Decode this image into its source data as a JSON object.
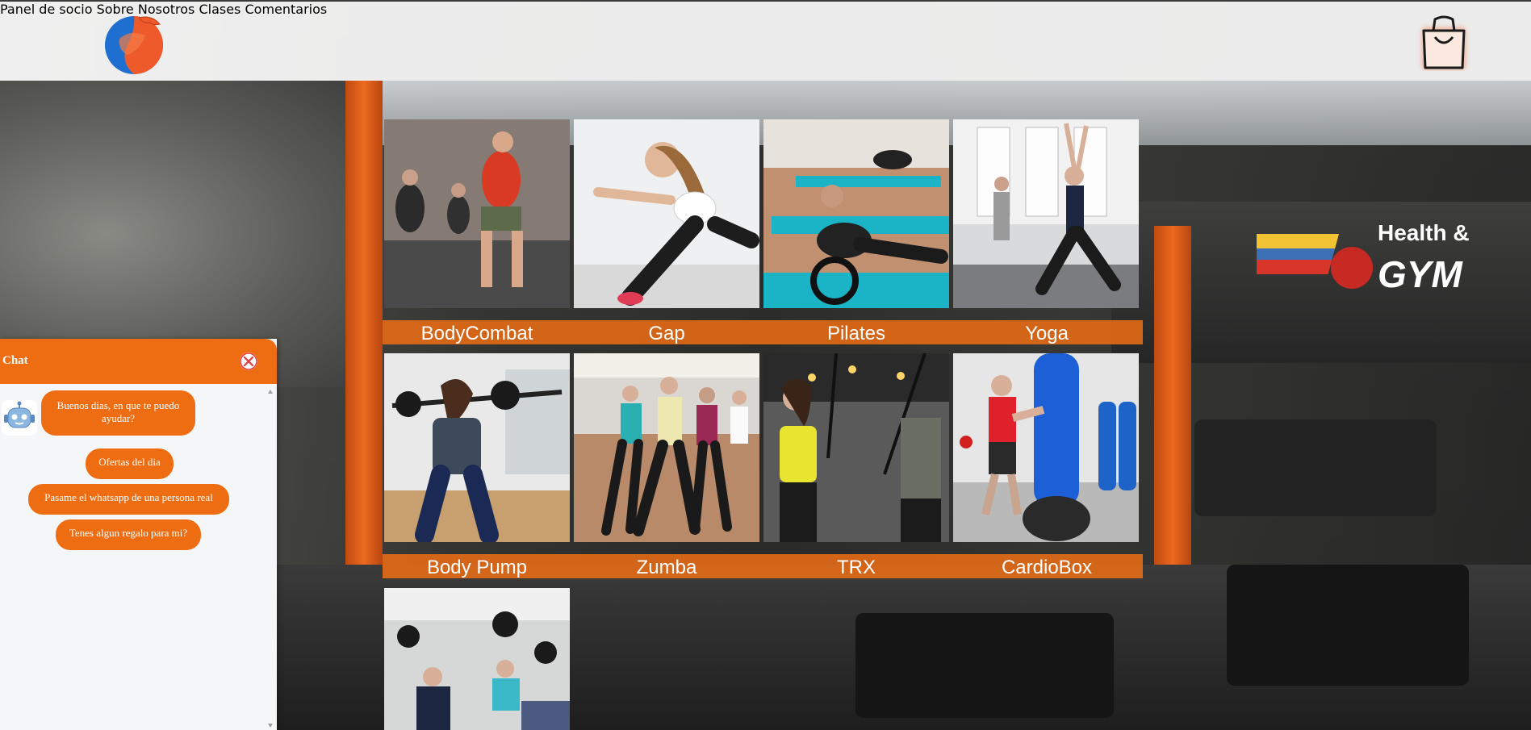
{
  "header": {
    "nav": [
      {
        "label": "Panel de socio"
      },
      {
        "label": "Sobre Nosotros"
      },
      {
        "label": "Clases"
      },
      {
        "label": "Comentarios"
      }
    ],
    "logo_icon": "arm-bicep-logo",
    "cart_icon": "shopping-bag-icon"
  },
  "classes": [
    {
      "name": "BodyCombat"
    },
    {
      "name": "Gap"
    },
    {
      "name": "Pilates"
    },
    {
      "name": "Yoga"
    },
    {
      "name": "Body Pump"
    },
    {
      "name": "Zumba"
    },
    {
      "name": "TRX"
    },
    {
      "name": "CardioBox"
    }
  ],
  "background_sign": {
    "text_1": "Health &",
    "text_2": "GYM"
  },
  "chat": {
    "title": "Chat",
    "bot_message": "Buenos dias, en que te puedo ayudar?",
    "options": [
      "Ofertas del dia",
      "Pasame el whatsapp de una persona real",
      "Tenes algun regalo para mi?"
    ]
  },
  "colors": {
    "accent": "#ee6d12",
    "band": "#e86c14",
    "header_bg": "#fafafa"
  }
}
